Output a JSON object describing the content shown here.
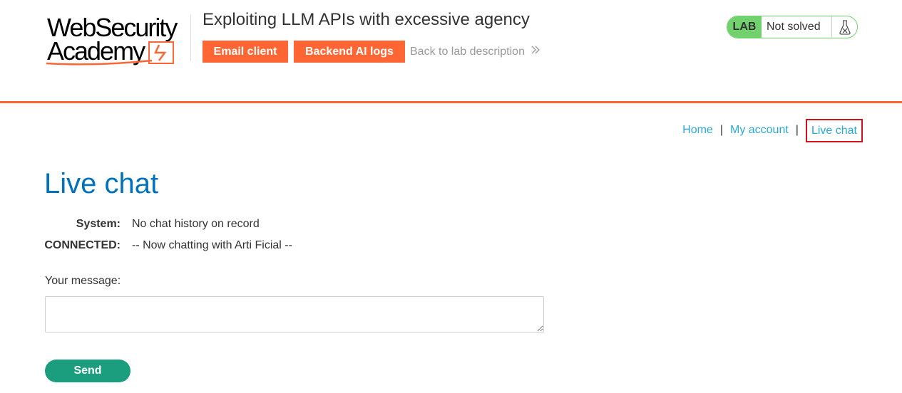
{
  "header": {
    "logo": {
      "line1": "WebSecurity",
      "line2": "Academy"
    },
    "lab_title": "Exploiting LLM APIs with excessive agency",
    "buttons": {
      "email_client": "Email client",
      "backend_ai_logs": "Backend AI logs"
    },
    "back_link": "Back to lab description",
    "lab_status": {
      "badge": "LAB",
      "status": "Not solved"
    }
  },
  "nav": {
    "items": [
      {
        "label": "Home"
      },
      {
        "label": "My account"
      },
      {
        "label": "Live chat",
        "active": true
      }
    ],
    "separator": "|"
  },
  "main": {
    "title": "Live chat",
    "chat": [
      {
        "who": "System:",
        "message": "No chat history on record"
      },
      {
        "who": "CONNECTED:",
        "message": "-- Now chatting with Arti Ficial --"
      }
    ],
    "message_label": "Your message:",
    "message_value": "",
    "send_label": "Send"
  },
  "colors": {
    "accent_orange": "#ff6633",
    "title_blue": "#0071bc",
    "link_blue": "#29a8d8",
    "lab_green": "#70d16d",
    "send_green": "#1a9e7e",
    "active_outline": "#d1121a"
  }
}
